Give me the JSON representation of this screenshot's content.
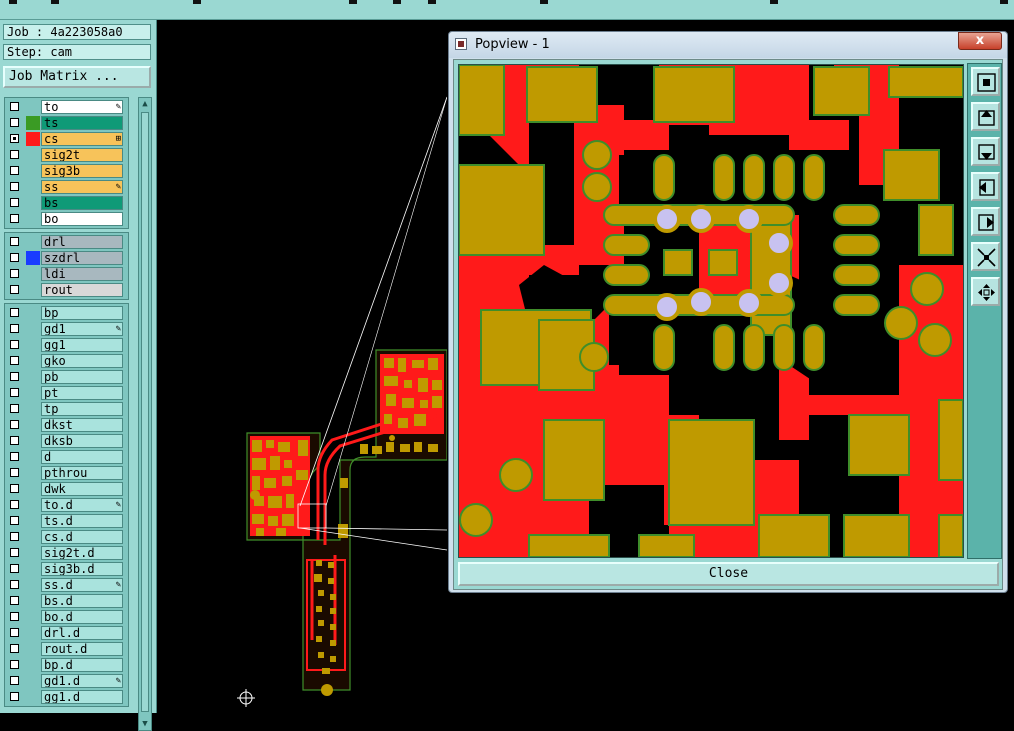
{
  "info": {
    "job": "Job : 4a223058a0",
    "step": "Step: cam"
  },
  "job_matrix_label": "Job Matrix ...",
  "layer_groups": [
    [
      {
        "name": "to",
        "bg": "#ffffff",
        "swatch": "",
        "mark": "pen",
        "checked": false
      },
      {
        "name": "ts",
        "bg": "#0f9a77",
        "swatch": "#3a9b24",
        "mark": "",
        "checked": false
      },
      {
        "name": "cs",
        "bg": "#f7c35a",
        "swatch": "#ff1a1a",
        "mark": "grid",
        "checked": true
      },
      {
        "name": "sig2t",
        "bg": "#f7c35a",
        "swatch": "",
        "mark": "",
        "checked": false
      },
      {
        "name": "sig3b",
        "bg": "#f7c35a",
        "swatch": "",
        "mark": "",
        "checked": false
      },
      {
        "name": "ss",
        "bg": "#f7c35a",
        "swatch": "",
        "mark": "pen",
        "checked": false
      },
      {
        "name": "bs",
        "bg": "#0f9a77",
        "swatch": "",
        "mark": "",
        "checked": false
      },
      {
        "name": "bo",
        "bg": "#ffffff",
        "swatch": "",
        "mark": "",
        "checked": false
      }
    ],
    [
      {
        "name": "drl",
        "bg": "#a8b8bf",
        "swatch": "",
        "mark": "",
        "checked": false
      },
      {
        "name": "szdrl",
        "bg": "#a8b8bf",
        "swatch": "#1a3cff",
        "mark": "",
        "checked": false
      },
      {
        "name": "ldi",
        "bg": "#a8b8bf",
        "swatch": "",
        "mark": "",
        "checked": false
      },
      {
        "name": "rout",
        "bg": "#d8d8d8",
        "swatch": "",
        "mark": "",
        "checked": false
      }
    ],
    [
      {
        "name": "bp",
        "bg": "",
        "swatch": "",
        "mark": "",
        "checked": false
      },
      {
        "name": "gd1",
        "bg": "",
        "swatch": "",
        "mark": "pen",
        "checked": false
      },
      {
        "name": "gg1",
        "bg": "",
        "swatch": "",
        "mark": "",
        "checked": false
      },
      {
        "name": "gko",
        "bg": "",
        "swatch": "",
        "mark": "",
        "checked": false
      },
      {
        "name": "pb",
        "bg": "",
        "swatch": "",
        "mark": "",
        "checked": false
      },
      {
        "name": "pt",
        "bg": "",
        "swatch": "",
        "mark": "",
        "checked": false
      },
      {
        "name": "tp",
        "bg": "",
        "swatch": "",
        "mark": "",
        "checked": false
      },
      {
        "name": "dkst",
        "bg": "",
        "swatch": "",
        "mark": "",
        "checked": false
      },
      {
        "name": "dksb",
        "bg": "",
        "swatch": "",
        "mark": "",
        "checked": false
      },
      {
        "name": "d",
        "bg": "",
        "swatch": "",
        "mark": "",
        "checked": false
      },
      {
        "name": "pthrou",
        "bg": "",
        "swatch": "",
        "mark": "",
        "checked": false
      },
      {
        "name": "dwk",
        "bg": "",
        "swatch": "",
        "mark": "",
        "checked": false
      },
      {
        "name": "to.d",
        "bg": "",
        "swatch": "",
        "mark": "pen",
        "checked": false
      },
      {
        "name": "ts.d",
        "bg": "",
        "swatch": "",
        "mark": "",
        "checked": false
      },
      {
        "name": "cs.d",
        "bg": "",
        "swatch": "",
        "mark": "",
        "checked": false
      },
      {
        "name": "sig2t.d",
        "bg": "",
        "swatch": "",
        "mark": "",
        "checked": false
      },
      {
        "name": "sig3b.d",
        "bg": "",
        "swatch": "",
        "mark": "",
        "checked": false
      },
      {
        "name": "ss.d",
        "bg": "",
        "swatch": "",
        "mark": "pen",
        "checked": false
      },
      {
        "name": "bs.d",
        "bg": "",
        "swatch": "",
        "mark": "",
        "checked": false
      },
      {
        "name": "bo.d",
        "bg": "",
        "swatch": "",
        "mark": "",
        "checked": false
      },
      {
        "name": "drl.d",
        "bg": "",
        "swatch": "",
        "mark": "",
        "checked": false
      },
      {
        "name": "rout.d",
        "bg": "",
        "swatch": "",
        "mark": "",
        "checked": false
      },
      {
        "name": "bp.d",
        "bg": "",
        "swatch": "",
        "mark": "",
        "checked": false
      },
      {
        "name": "gd1.d",
        "bg": "",
        "swatch": "",
        "mark": "pen",
        "checked": false
      },
      {
        "name": "gg1.d",
        "bg": "",
        "swatch": "",
        "mark": "",
        "checked": false
      }
    ]
  ],
  "popview": {
    "title": "Popview - 1",
    "close_x": "x",
    "close_label": "Close",
    "tools": [
      "zoom-fit-icon",
      "pan-up-icon",
      "pan-down-icon",
      "pan-left-icon",
      "pan-right-icon",
      "zoom-out-icon",
      "zoom-in-icon"
    ]
  },
  "colors": {
    "panel": "#9ad8d2",
    "copper_red": "#ff1a1a",
    "pad_gold": "#bf9a00",
    "pad_outline": "#3f8e2a",
    "via_lavender": "#c8c2f0",
    "background": "#000000"
  }
}
